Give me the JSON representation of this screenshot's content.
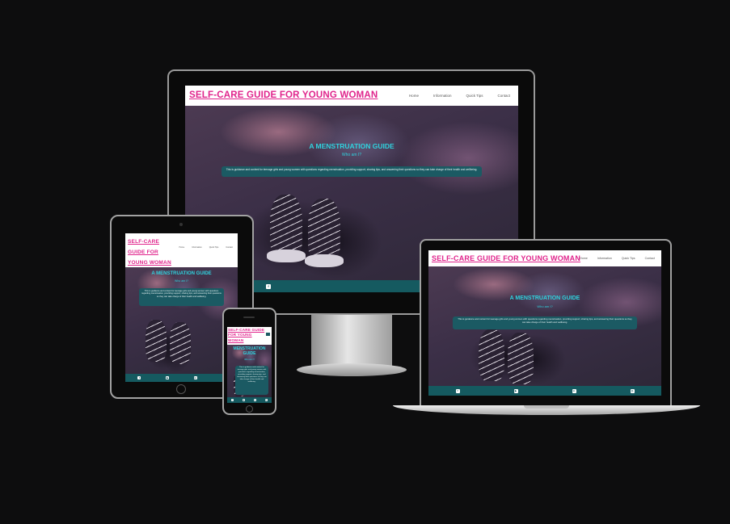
{
  "site": {
    "brand": "SELF-CARE GUIDE FOR YOUNG WOMAN",
    "brand_tablet_lines": [
      "SELF-CARE",
      "GUIDE FOR",
      "YOUNG WOMAN"
    ],
    "brand_phone_lines": [
      "SELF-CARE GUIDE",
      "FOR YOUNG",
      "WOMAN"
    ],
    "nav": [
      "Home",
      "Information",
      "Quick Tips",
      "Contact"
    ],
    "nav_tablet": [
      "Home",
      "Information",
      "Quick Tips",
      "Contact"
    ],
    "hero_title": "A MENSTRUATION GUIDE",
    "hero_title_phone_lines": [
      "MENSTRUATION",
      "GUIDE"
    ],
    "hero_subtitle": "Who am I?",
    "intro_text": "This is guidance and content for teenage girls and young women with questions regarding menstruation, providing support, sharing tips, and answering their questions so they can take charge of their health and wellbeing.",
    "footer_icons": [
      "f",
      "▶",
      "in",
      "◎"
    ]
  },
  "colors": {
    "brand": "#e0248c",
    "accent": "#2fd3df",
    "footer": "#155a60",
    "background": "#0d0d0e"
  }
}
